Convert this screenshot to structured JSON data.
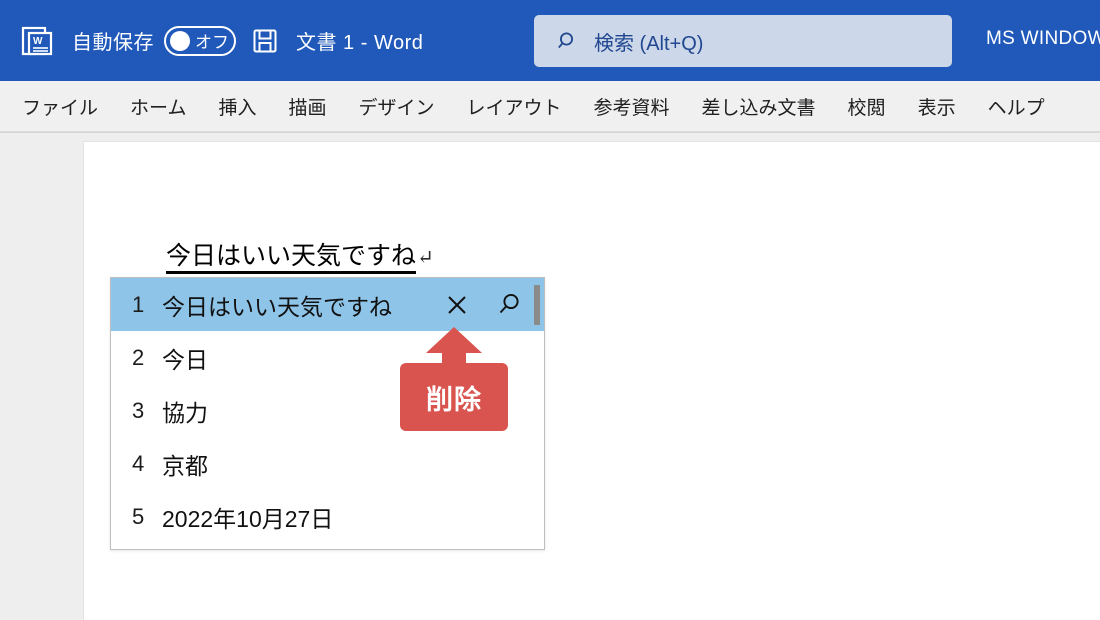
{
  "titlebar": {
    "app_icon": "word-icon",
    "autosave_label": "自動保存",
    "autosave_state": "オフ",
    "save_icon": "save-icon",
    "document_title": "文書 1  -  Word",
    "account_name": "MS WINDOW",
    "background_color": "#2159ba"
  },
  "search": {
    "icon": "search-icon",
    "placeholder": "検索 (Alt+Q)",
    "value": "",
    "background_color": "#ccd7ea"
  },
  "ribbon": {
    "tabs": [
      {
        "label": "ファイル"
      },
      {
        "label": "ホーム"
      },
      {
        "label": "挿入"
      },
      {
        "label": "描画"
      },
      {
        "label": "デザイン"
      },
      {
        "label": "レイアウト"
      },
      {
        "label": "参考資料"
      },
      {
        "label": "差し込み文書"
      },
      {
        "label": "校閲"
      },
      {
        "label": "表示"
      },
      {
        "label": "ヘルプ"
      }
    ]
  },
  "document": {
    "composition_text": "今日はいい天気ですね",
    "paragraph_mark": "↵"
  },
  "ime": {
    "selected_index": 1,
    "candidates": [
      {
        "index": "1",
        "text": "今日はいい天気ですね"
      },
      {
        "index": "2",
        "text": "今日"
      },
      {
        "index": "3",
        "text": "協力"
      },
      {
        "index": "4",
        "text": "京都"
      },
      {
        "index": "5",
        "text": "2022年10月27日"
      }
    ],
    "delete_icon": "close-icon",
    "search_icon": "magnifier-icon",
    "highlight_color": "#8ec4e8"
  },
  "annotation": {
    "label": "削除",
    "color": "#d9534f",
    "arrow_direction": "up"
  }
}
